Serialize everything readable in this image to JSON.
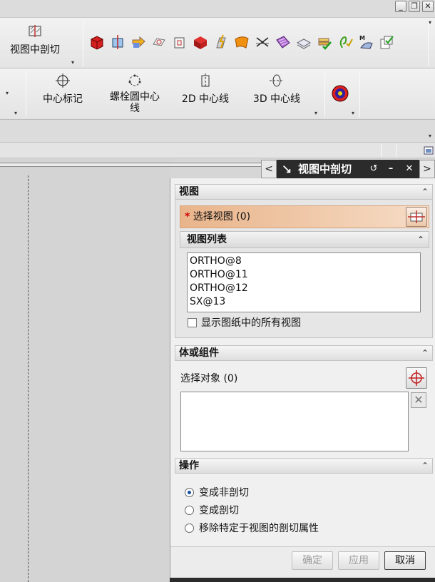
{
  "window_controls": {
    "minimize": "_",
    "restore": "❐",
    "close": "✕"
  },
  "ribbon": {
    "group1_label": "视图中剖切",
    "group2": [
      {
        "label": "中心标记"
      },
      {
        "label": "螺栓圆中心线"
      },
      {
        "label": "2D 中心线"
      },
      {
        "label": "3D 中心线"
      }
    ]
  },
  "dialog": {
    "title": "视图中剖切",
    "nav_left": "<",
    "nav_right": ">",
    "reset_icon": "↺",
    "minimize": "–",
    "close": "✕",
    "section_view": {
      "header": "视图",
      "select_required_mark": "*",
      "select_label": "选择视图 (0)",
      "list_header": "视图列表",
      "list_items": [
        "ORTHO@8",
        "ORTHO@11",
        "ORTHO@12",
        "SX@13"
      ],
      "show_all_label": "显示图纸中的所有视图",
      "show_all_checked": false
    },
    "section_body": {
      "header": "体或组件",
      "select_label": "选择对象 (0)"
    },
    "section_ops": {
      "header": "操作",
      "options": [
        {
          "label": "变成非剖切",
          "selected": true
        },
        {
          "label": "变成剖切",
          "selected": false
        },
        {
          "label": "移除特定于视图的剖切属性",
          "selected": false
        }
      ]
    },
    "buttons": {
      "ok": "确定",
      "apply": "应用",
      "cancel": "取消"
    }
  },
  "icons": {
    "chevron_up": "⌃",
    "dropdown": "▾",
    "remove": "✕"
  },
  "colors": {
    "title_bar": "#2b2b2b",
    "required_row": "#e9b48a",
    "required_mark": "#d00000"
  }
}
